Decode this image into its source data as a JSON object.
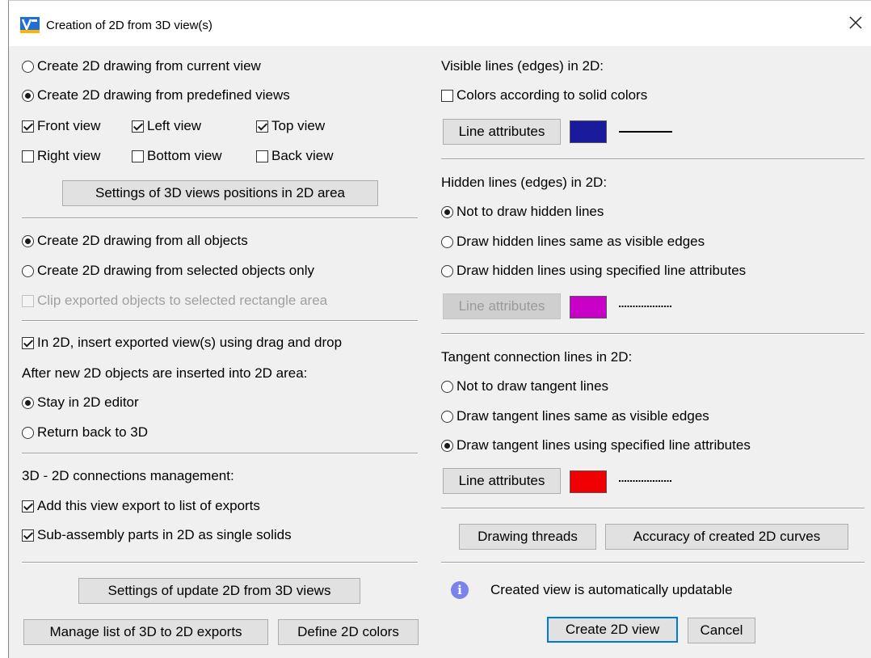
{
  "window": {
    "title": "Creation of 2D from 3D view(s)"
  },
  "left": {
    "view_mode": {
      "current_view": "Create 2D drawing from current view",
      "predefined_views": "Create 2D drawing from predefined views"
    },
    "views": {
      "front": "Front view",
      "left": "Left view",
      "top": "Top view",
      "right": "Right view",
      "bottom": "Bottom view",
      "back": "Back view"
    },
    "settings_positions_button": "Settings of 3D views positions in 2D area",
    "objects": {
      "all": "Create 2D drawing from all objects",
      "selected": "Create 2D drawing from selected objects only",
      "clip": "Clip exported objects to selected rectangle area"
    },
    "insert_drag_drop": "In 2D, insert exported view(s) using drag and drop",
    "after_insert_label": "After new 2D objects are inserted into 2D area:",
    "after_insert": {
      "stay": "Stay in 2D editor",
      "return": "Return back to 3D"
    },
    "connections_label": "3D - 2D connections management:",
    "add_to_list": "Add this view export to list of exports",
    "subassembly": "Sub-assembly parts in 2D as single solids",
    "settings_update_button": "Settings of update 2D from 3D views",
    "manage_list_button": "Manage list of 3D to 2D exports",
    "define_colors_button": "Define 2D colors"
  },
  "right": {
    "visible": {
      "label": "Visible lines (edges) in 2D:",
      "colors_solid": "Colors according to solid colors",
      "line_attributes_button": "Line attributes",
      "color": "#1a1a9c"
    },
    "hidden": {
      "label": "Hidden lines (edges) in 2D:",
      "not_draw": "Not to draw hidden lines",
      "same_as_visible": "Draw hidden lines same as visible edges",
      "specified": "Draw hidden lines using specified line attributes",
      "line_attributes_button": "Line attributes",
      "color": "#c800c8"
    },
    "tangent": {
      "label": "Tangent connection lines in 2D:",
      "not_draw": "Not to draw tangent lines",
      "same_as_visible": "Draw tangent lines same as visible edges",
      "specified": "Draw tangent lines using specified line attributes",
      "line_attributes_button": "Line attributes",
      "color": "#f00000"
    },
    "drawing_threads_button": "Drawing threads",
    "accuracy_button": "Accuracy of created 2D curves",
    "info_text": "Created view is automatically updatable",
    "create_button": "Create 2D view",
    "cancel_button": "Cancel"
  },
  "colors": {
    "accent": "#0078d7",
    "info_icon": "#7b83eb"
  }
}
